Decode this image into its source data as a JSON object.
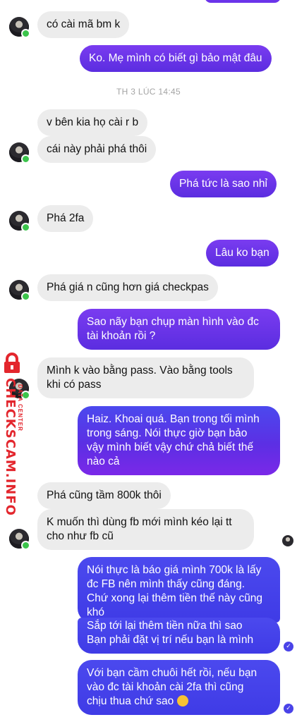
{
  "timestamp": "TH 3 LÚC 14:45",
  "messages": {
    "m1": "có cài mã bm k",
    "m2": "Ko. Mẹ mình có biết gì bảo mật đâu",
    "m3": "v bên kia họ cài r b",
    "m4": "cái này phải phá thôi",
    "m5": "Phá tức là sao nhỉ",
    "m6": "Phá 2fa",
    "m7": "Lâu ko bạn",
    "m8": "Phá giá n cũng hơn giá checkpas",
    "m9": [
      "Sao nãy bạn chụp màn hình vào đc",
      "tài khoản rồi ?"
    ],
    "m10": [
      "Mình k vào bằng pass. Vào bằng tools",
      "khi có pass"
    ],
    "m11": [
      "Haiz. Khoai quá. Bạn trong tối mình",
      "trong sáng. Nói thực giờ bạn bảo",
      "vậy mình biết vậy chứ chả biết thế",
      "nào cả"
    ],
    "m12": "Phá cũng tầm 800k thôi",
    "m13": [
      "K muốn thì dùng fb mới mình kéo lại tt",
      "cho như fb cũ"
    ],
    "m14": [
      "Nói thực là báo giá mình 700k là lấy",
      "đc FB nên mình thấy cũng đáng.",
      "Chứ xong lại thêm tiền thế này cũng",
      "khó"
    ],
    "m15": [
      "Sắp tới lại thêm tiền nữa thì sao",
      "Bạn phải đặt vị trí nếu bạn là mình"
    ],
    "m16": [
      "Với bạn cầm chuôi hết rồi, nếu bạn",
      "vào đc tài khoản cài 2fa thì cũng",
      "chịu thua chứ sao"
    ]
  },
  "watermark": {
    "brand": "CHECKSCAM.INFO",
    "sub": "DATA CENTER"
  },
  "colors": {
    "outgoing_purple": "#7a3cf0",
    "outgoing_blue": "#4b49ee",
    "incoming_gray": "#ececec",
    "watermark_red": "#e3262d"
  }
}
